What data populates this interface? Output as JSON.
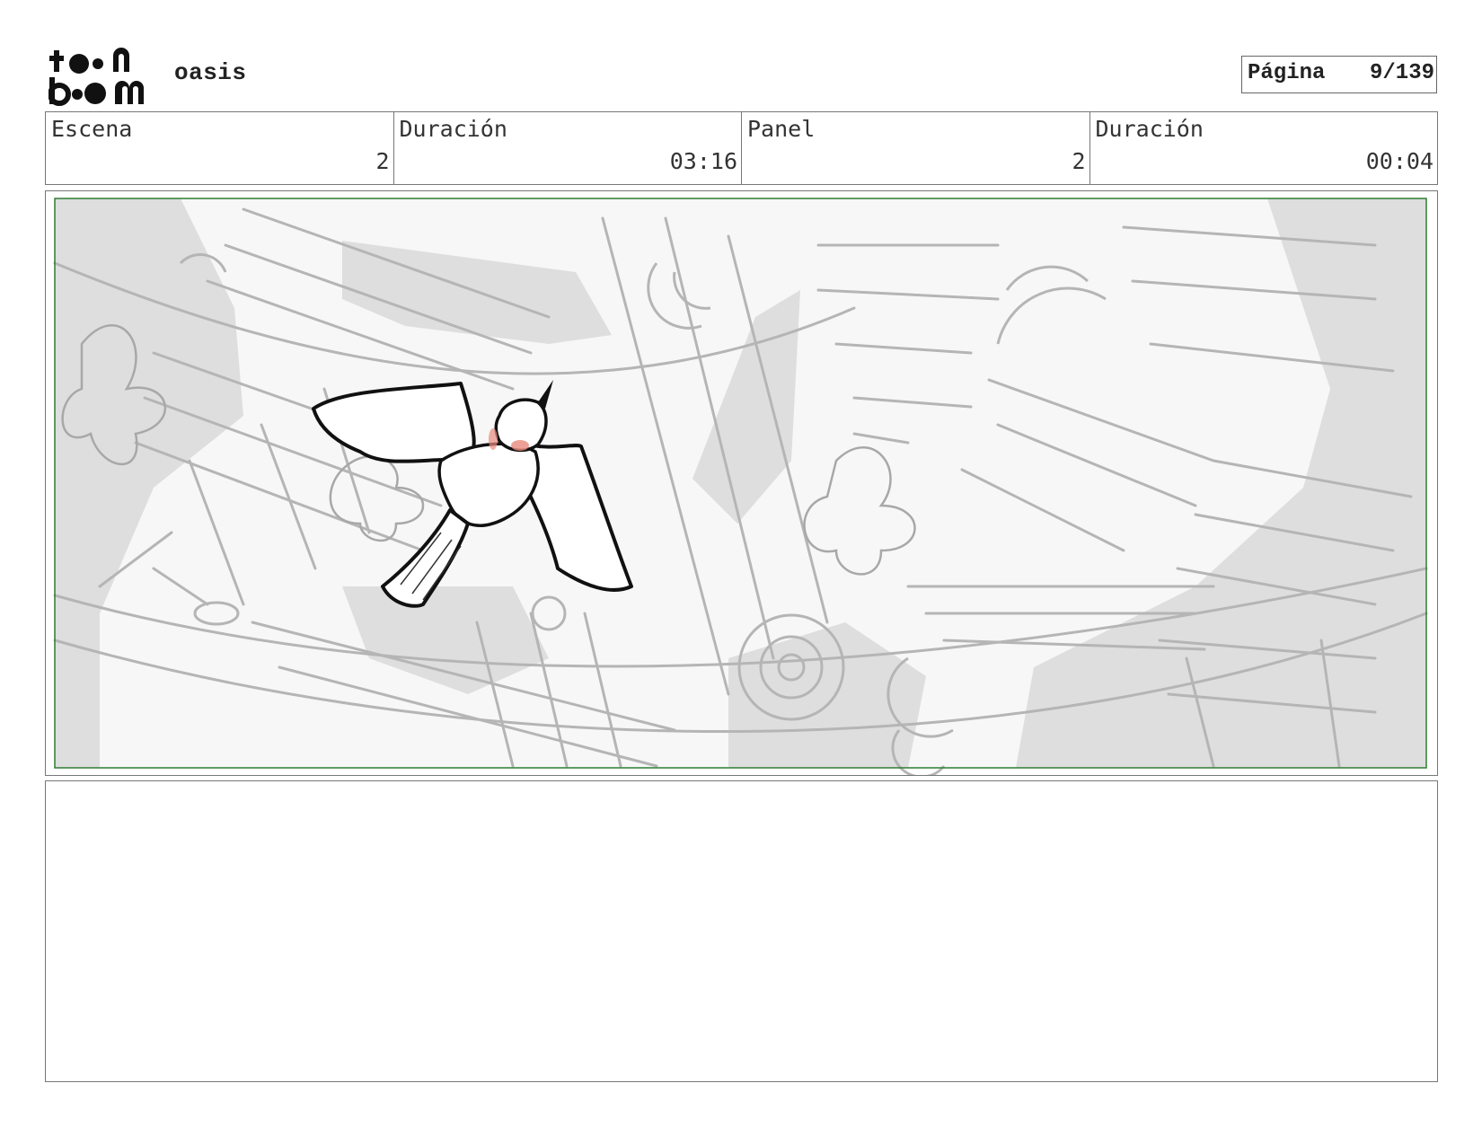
{
  "header": {
    "logo_line1": "toon",
    "logo_line2": "boom",
    "project_title": "oasis",
    "page_label": "Página",
    "page_number": "9/139"
  },
  "info": {
    "scene_label": "Escena",
    "scene_value": "2",
    "scene_duration_label": "Duración",
    "scene_duration_value": "03:16",
    "panel_label": "Panel",
    "panel_value": "2",
    "panel_duration_label": "Duración",
    "panel_duration_value": "00:04"
  },
  "panel": {
    "icons": [
      "bird-sketch-icon"
    ],
    "colors": {
      "frame_border": "#2e7d32",
      "sketch_gray": "#bdbdbd",
      "bird_blush": "#e98a7c"
    }
  },
  "notes": {
    "text": ""
  }
}
